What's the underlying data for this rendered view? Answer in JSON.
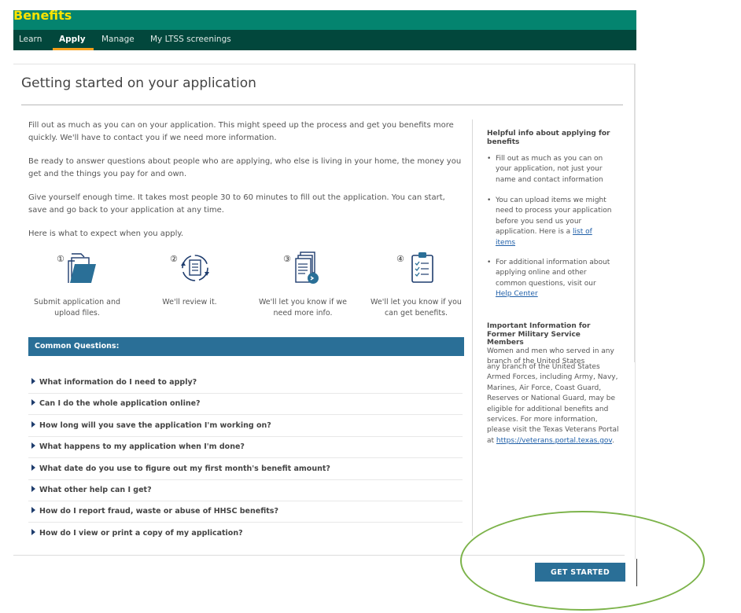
{
  "header": {
    "brand": "Benefits",
    "tabs": [
      {
        "label": "Learn",
        "active": false
      },
      {
        "label": "Apply",
        "active": true
      },
      {
        "label": "Manage",
        "active": false
      },
      {
        "label": "My LTSS screenings",
        "active": false
      }
    ]
  },
  "page": {
    "title": "Getting started on your application",
    "paragraphs": [
      "Fill out as much as you can on your application. This might speed up the process and get you benefits more quickly. We'll have to contact you if we need more information.",
      "Be ready to answer questions about people who are applying, who else is living in your home, the money you get and the things you pay for and own.",
      "Give yourself enough time. It takes most people 30 to 60 minutes to fill out the application. You can start, save and go back to your application at any time.",
      "Here is what to expect when you apply."
    ],
    "steps": [
      {
        "number": "①",
        "icon": "folder-icon",
        "caption": "Submit application and upload files."
      },
      {
        "number": "②",
        "icon": "review-cycle-icon",
        "caption": "We'll review it."
      },
      {
        "number": "③",
        "icon": "documents-icon",
        "caption": "We'll let you know if we need more info."
      },
      {
        "number": "④",
        "icon": "clipboard-checklist-icon",
        "caption": "We'll let you know if you can get benefits."
      }
    ]
  },
  "questions": {
    "title": "Common Questions:",
    "items": [
      "What information do I need to apply?",
      "Can I do the whole application online?",
      "How long will you save the application I'm working on?",
      "What happens to my application when I'm done?",
      "What date do you use to figure out my first month's benefit amount?",
      "What other help can I get?",
      "How do I report fraud, waste or abuse of HHSC benefits?",
      "How do I view or print a copy of my application?"
    ]
  },
  "sidebar": {
    "helpful_heading": "Helpful info about applying for benefits",
    "bullet1": "Fill out as much as you can on your application, not just your name and contact information",
    "bullet2_text": "You can upload items we might need to process your application before you send us your application. Here is a ",
    "bullet2_link": "list of items",
    "bullet3_text": "For additional information about applying online and other common questions, visit our ",
    "bullet3_link": "Help Center",
    "military_heading": "Important Information for Former Military Service Members",
    "military_intro": "Women and men who served in any branch of the United States",
    "military_text": "any branch of the United States Armed Forces, including Army, Navy, Marines, Air Force, Coast Guard, Reserves or National Guard, may be eligible for additional benefits and services. For more information, please visit the Texas Veterans Portal at ",
    "military_link": "https://veterans.portal.texas.gov",
    "military_end": "."
  },
  "actions": {
    "get_started": "GET STARTED"
  },
  "colors": {
    "brand_bar": "#04846f",
    "nav_bar": "#02473c",
    "brand_text": "#fee300",
    "active_tab_underline": "#f5a01a",
    "primary_blue": "#2a6f97",
    "annotation_ellipse": "#7cb34a"
  }
}
